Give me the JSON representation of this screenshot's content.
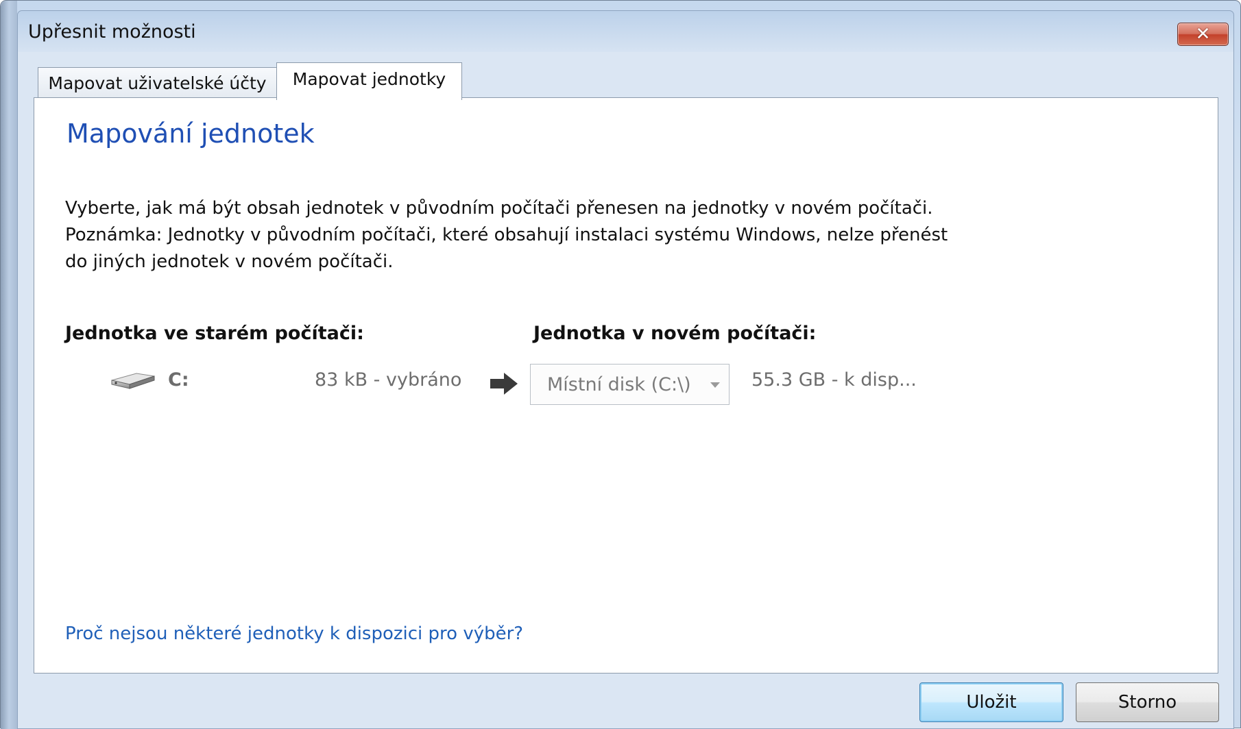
{
  "window": {
    "title": "Upřesnit možnosti",
    "close_symbol": "✕"
  },
  "tabs": [
    {
      "label": "Mapovat uživatelské účty",
      "active": false
    },
    {
      "label": "Mapovat jednotky",
      "active": true
    }
  ],
  "main": {
    "heading": "Mapování  jednotek",
    "description_lines": [
      "Vyberte, jak má být obsah jednotek v původním počítači přenesen na jednotky v novém počítači.",
      "Poznámka: Jednotky v původním počítači, které obsahují instalaci systému Windows, nelze přenést",
      "do jiných jednotek v novém počítači."
    ],
    "old_drive_label": "Jednotka ve starém počítači:",
    "new_drive_label": "Jednotka v novém počítači:",
    "drive_row": {
      "drive_icon": "hard-drive-icon",
      "letter": "C:",
      "size": "83 kB - vybráno",
      "arrow_icon": "arrow-right-icon",
      "target_selected": "Místní disk (C:\\)",
      "target_free": "55.3 GB - k disp..."
    },
    "help_link": "Proč nejsou některé jednotky k dispozici pro výběr?"
  },
  "footer": {
    "save_label": "Uložit",
    "cancel_label": "Storno"
  },
  "colors": {
    "heading": "#1f4fb4",
    "link": "#1f5fb8",
    "close_button": "#c3412b",
    "disabled_text": "#6d6d6d"
  }
}
